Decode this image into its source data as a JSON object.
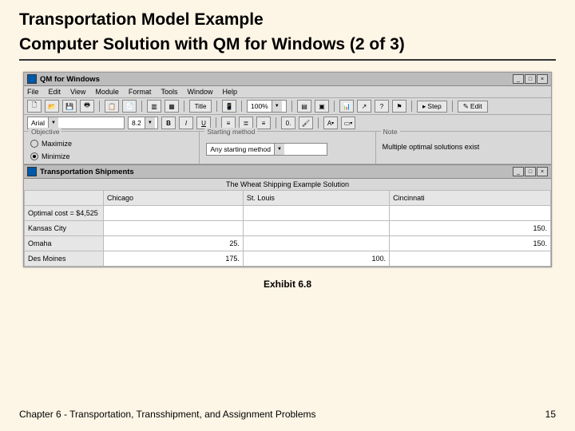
{
  "slide": {
    "title_l1": "Transportation Model Example",
    "title_l2": "Computer Solution with QM for Windows (2 of 3)",
    "caption": "Exhibit 6.8",
    "footer_left": "Chapter 6 - Transportation, Transshipment, and Assignment Problems",
    "footer_right": "15"
  },
  "app": {
    "title": "QM for Windows",
    "menu": [
      "File",
      "Edit",
      "View",
      "Module",
      "Format",
      "Tools",
      "Window",
      "Help"
    ],
    "font_name": "Arial",
    "font_size": "8.2",
    "zoom": "100%",
    "step_label": "Step",
    "edit_label": "Edit",
    "bold": "B",
    "italic": "I",
    "underline": "U",
    "objective": {
      "label": "Objective",
      "opts": [
        "Maximize",
        "Minimize"
      ],
      "selected": 1
    },
    "starting": {
      "label": "Starting method",
      "value": "Any starting method"
    },
    "note": {
      "label": "Note",
      "text": "Multiple optimal solutions exist"
    }
  },
  "subwin": {
    "title": "Transportation Shipments",
    "header": "The Wheat Shipping Example Solution",
    "cols": [
      "",
      "Chicago",
      "St. Louis",
      "Cincinnati"
    ],
    "rows": [
      {
        "h": "Optimal cost = $4,525",
        "v": [
          "",
          "",
          ""
        ]
      },
      {
        "h": "Kansas City",
        "v": [
          "",
          "",
          "150."
        ]
      },
      {
        "h": "Omaha",
        "v": [
          "25.",
          "",
          "150."
        ]
      },
      {
        "h": "Des Moines",
        "v": [
          "175.",
          "100.",
          ""
        ]
      }
    ]
  },
  "chart_data": {
    "type": "table",
    "title": "Transportation Shipments — The Wheat Shipping Example Solution",
    "optimal_cost": 4525,
    "columns": [
      "Chicago",
      "St. Louis",
      "Cincinnati"
    ],
    "rows": [
      "Kansas City",
      "Omaha",
      "Des Moines"
    ],
    "values": [
      [
        null,
        null,
        150
      ],
      [
        25,
        null,
        150
      ],
      [
        175,
        100,
        null
      ]
    ]
  }
}
